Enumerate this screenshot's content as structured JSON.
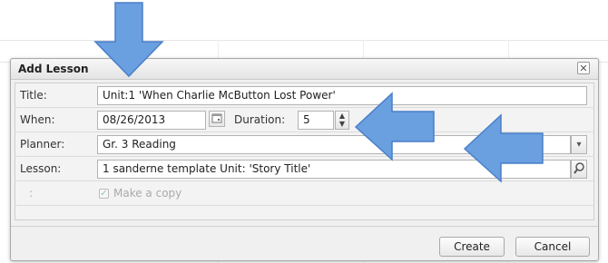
{
  "dialog": {
    "title": "Add Lesson",
    "close_glyph": "✕"
  },
  "form": {
    "title_label": "Title:",
    "title_value": "Unit:1 'When Charlie McButton Lost Power'",
    "when_label": "When:",
    "when_value": "08/26/2013",
    "duration_label": "Duration:",
    "duration_value": "5",
    "planner_label": "Planner:",
    "planner_value": "Gr. 3 Reading",
    "lesson_label": "Lesson:",
    "lesson_value": "1 sanderne template  Unit:  'Story Title'",
    "copy_label_prefix": ":",
    "copy_checkbox_label": "Make a copy"
  },
  "buttons": {
    "create": "Create",
    "cancel": "Cancel"
  },
  "icons": {
    "calendar": "calendar-icon",
    "spinner": "spinner-icon",
    "dropdown": "chevron-down-icon",
    "search": "search-icon",
    "annotation": "arrow-annotation"
  },
  "colors": {
    "arrow_fill": "#6a9fe0",
    "arrow_stroke": "#4a7fc8"
  }
}
